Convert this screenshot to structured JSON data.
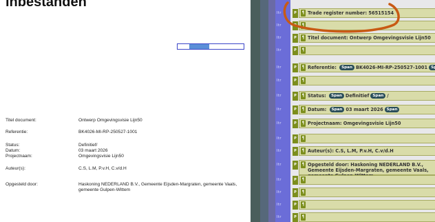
{
  "page_title": "inbestanden",
  "progress": {
    "value": 0.3
  },
  "left_fields": [
    {
      "label": "Titel document:",
      "value": "Ontwerp Omgevingsvisie Lijn50"
    },
    {
      "label": "Referentie:",
      "value": "BK4026-MI-RP-250527-1001"
    },
    {
      "label": "Status:",
      "value": "Definitief/"
    },
    {
      "label": "Datum:",
      "value": "03 maart 2026"
    },
    {
      "label": "Projectnaam:",
      "value": "Omgevingsvisie Lijn50"
    },
    {
      "label": "Auteur(s):",
      "value": "C.S, L.M, P.v.H, C.v/d.H"
    },
    {
      "label": "Opgesteld door:",
      "value": "Haskoning NEDERLAND B.V., Gemeente Eijsden-Margraten, gemeente Vaals, gemeente Gulpen-Wittem"
    }
  ],
  "editor": {
    "dir_label": "ltr",
    "p_marker": "P",
    "pilcrow": "¶",
    "span_label": "Span",
    "rows": [
      {
        "text": "Trade register number: 56515154"
      },
      {
        "text": ""
      },
      {
        "text": "Titel document: Ontwerp Omgevingsvisie Lijn50"
      },
      {
        "text": ""
      },
      {
        "text": "Referentie:",
        "span_value": "BK4026-MI-RP-250527-1001"
      },
      {
        "text": ""
      },
      {
        "text": "Status:",
        "span_value": "Definitief",
        "suffix": "/"
      },
      {
        "text": "Datum:",
        "span_value": "03 maart 2026"
      },
      {
        "text": "Projectnaam: Omgevingsvisie Lijn50"
      },
      {
        "text": ""
      },
      {
        "text": "Auteur(s): C.S, L.M, P.v.H, C.v/d.H"
      },
      {
        "text": "Opgesteld door: Haskoning NEDERLAND B.V., Gemeente Eijsden-Margraten, gemeente Vaals, gemeente Gulpen-Wittem"
      },
      {
        "text": ""
      },
      {
        "text": ""
      },
      {
        "text": ""
      },
      {
        "text": ""
      }
    ]
  },
  "colors": {
    "annotation": "#c85a14",
    "accent_bar": "#3b45c8",
    "fill": "#5b8fd8"
  }
}
